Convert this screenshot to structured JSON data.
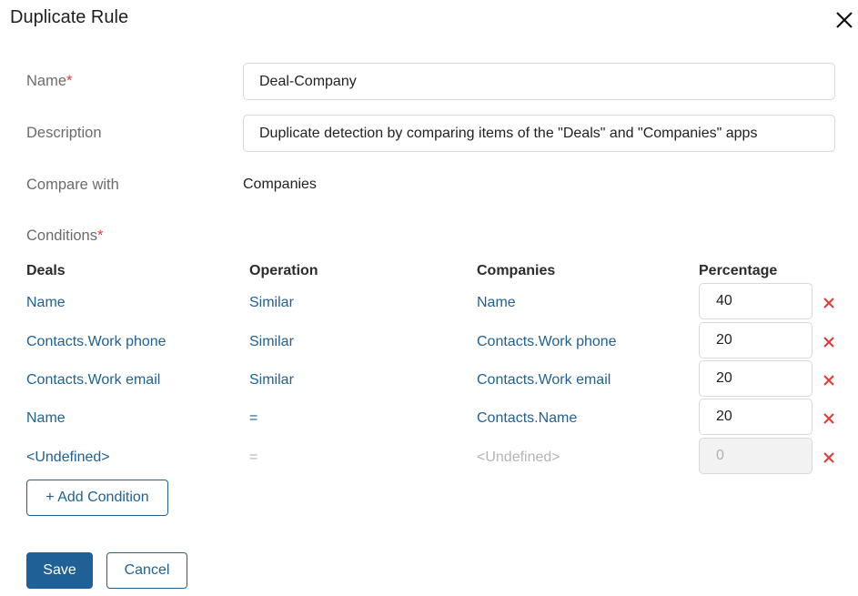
{
  "dialog": {
    "title": "Duplicate Rule",
    "close_icon": "close-icon"
  },
  "form": {
    "name": {
      "label": "Name",
      "required_mark": "*",
      "value": "Deal-Company"
    },
    "description": {
      "label": "Description",
      "value": "Duplicate detection by comparing items of the \"Deals\" and \"Companies\" apps"
    },
    "compare_with": {
      "label": "Compare with",
      "value": "Companies"
    },
    "conditions": {
      "label": "Conditions",
      "required_mark": "*"
    }
  },
  "conditions_table": {
    "headers": {
      "left": "Deals",
      "operation": "Operation",
      "right": "Companies",
      "percentage": "Percentage"
    },
    "rows": [
      {
        "left": "Name",
        "operation": "Similar",
        "right": "Name",
        "percentage": "40",
        "disabled": false
      },
      {
        "left": "Contacts.Work phone",
        "operation": "Similar",
        "right": "Contacts.Work phone",
        "percentage": "20",
        "disabled": false
      },
      {
        "left": "Contacts.Work email",
        "operation": "Similar",
        "right": "Contacts.Work email",
        "percentage": "20",
        "disabled": false
      },
      {
        "left": "Name",
        "operation": "=",
        "right": "Contacts.Name",
        "percentage": "20",
        "disabled": false
      },
      {
        "left": "<Undefined>",
        "operation": "=",
        "right": "<Undefined>",
        "percentage": "0",
        "disabled": true
      }
    ],
    "delete_icon": "delete-x-icon"
  },
  "buttons": {
    "add_condition": "+ Add Condition",
    "save": "Save",
    "cancel": "Cancel"
  },
  "colors": {
    "accent": "#1f6197",
    "required": "#e53935",
    "delete": "#e53935",
    "muted": "#b5b5b5"
  }
}
